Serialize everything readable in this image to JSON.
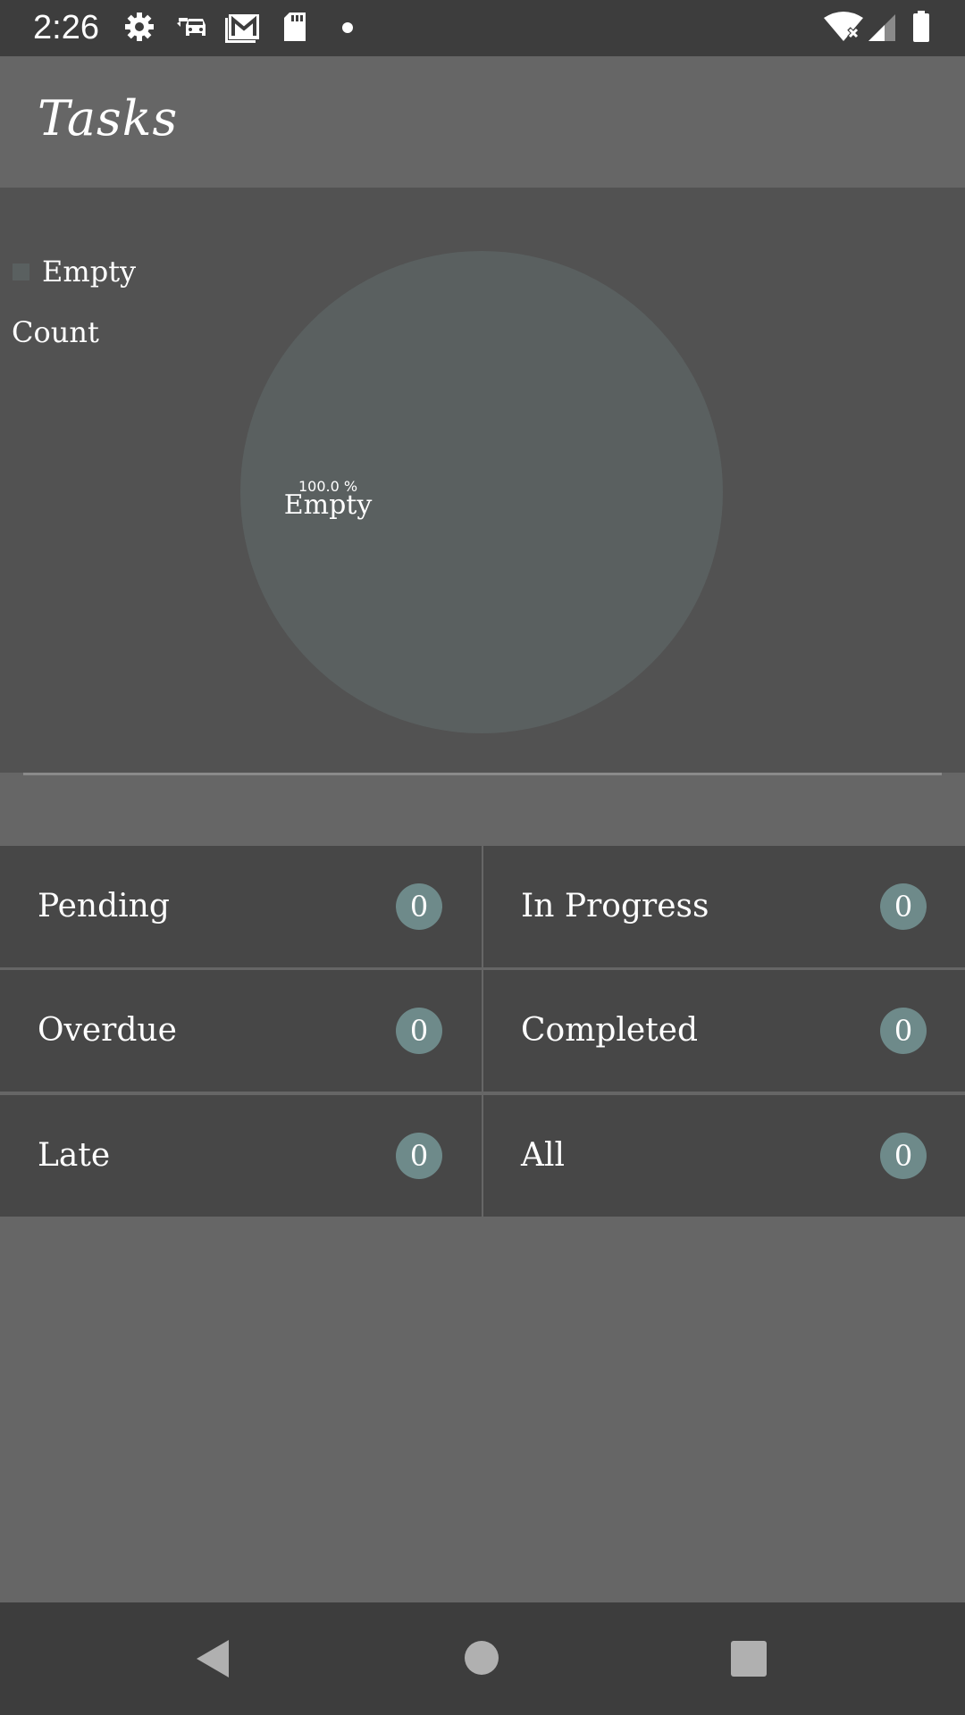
{
  "status_bar": {
    "time": "2:26",
    "icons": [
      "settings-icon",
      "car-sync-icon",
      "gmail-icon",
      "sd-card-icon",
      "dot-icon",
      "wifi-off-icon",
      "signal-icon",
      "battery-icon"
    ]
  },
  "app_bar": {
    "title": "Tasks"
  },
  "chart": {
    "legend_label": "Empty",
    "count_label": "Count",
    "slice_percent_label": "100.0 %",
    "slice_name_label": "Empty"
  },
  "chart_data": {
    "type": "pie",
    "title": "",
    "slices": [
      {
        "label": "Empty",
        "value": 100.0,
        "color": "#5a6060"
      }
    ]
  },
  "tiles": [
    {
      "label": "Pending",
      "count": "0"
    },
    {
      "label": "In Progress",
      "count": "0"
    },
    {
      "label": "Overdue",
      "count": "0"
    },
    {
      "label": "Completed",
      "count": "0"
    },
    {
      "label": "Late",
      "count": "0"
    },
    {
      "label": "All",
      "count": "0"
    }
  ],
  "colors": {
    "status_bar": "#3d3d3d",
    "app_bar": "#666666",
    "chart_panel": "#525252",
    "tile": "#474747",
    "badge": "#6e8a8a",
    "pie": "#5a6060"
  },
  "nav_bar": {
    "buttons": [
      "back-icon",
      "home-icon",
      "recents-icon"
    ]
  }
}
